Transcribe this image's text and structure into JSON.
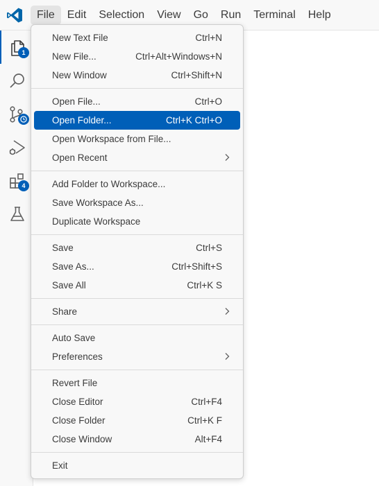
{
  "menubar": {
    "items": [
      {
        "label": "File"
      },
      {
        "label": "Edit"
      },
      {
        "label": "Selection"
      },
      {
        "label": "View"
      },
      {
        "label": "Go"
      },
      {
        "label": "Run"
      },
      {
        "label": "Terminal"
      },
      {
        "label": "Help"
      }
    ]
  },
  "activity_bar": {
    "explorer_badge": "1",
    "extensions_badge": "4",
    "icons": [
      "files-icon",
      "search-icon",
      "source-control-icon",
      "run-debug-icon",
      "extensions-icon",
      "testing-icon"
    ]
  },
  "file_menu": {
    "new_text_file": {
      "label": "New Text File",
      "shortcut": "Ctrl+N"
    },
    "new_file": {
      "label": "New File...",
      "shortcut": "Ctrl+Alt+Windows+N"
    },
    "new_window": {
      "label": "New Window",
      "shortcut": "Ctrl+Shift+N"
    },
    "open_file": {
      "label": "Open File...",
      "shortcut": "Ctrl+O"
    },
    "open_folder": {
      "label": "Open Folder...",
      "shortcut": "Ctrl+K Ctrl+O"
    },
    "open_workspace": {
      "label": "Open Workspace from File..."
    },
    "open_recent": {
      "label": "Open Recent"
    },
    "add_folder": {
      "label": "Add Folder to Workspace..."
    },
    "save_workspace_as": {
      "label": "Save Workspace As..."
    },
    "duplicate_workspace": {
      "label": "Duplicate Workspace"
    },
    "save": {
      "label": "Save",
      "shortcut": "Ctrl+S"
    },
    "save_as": {
      "label": "Save As...",
      "shortcut": "Ctrl+Shift+S"
    },
    "save_all": {
      "label": "Save All",
      "shortcut": "Ctrl+K S"
    },
    "share": {
      "label": "Share"
    },
    "auto_save": {
      "label": "Auto Save"
    },
    "preferences": {
      "label": "Preferences"
    },
    "revert_file": {
      "label": "Revert File"
    },
    "close_editor": {
      "label": "Close Editor",
      "shortcut": "Ctrl+F4"
    },
    "close_folder": {
      "label": "Close Folder",
      "shortcut": "Ctrl+K F"
    },
    "close_window": {
      "label": "Close Window",
      "shortcut": "Alt+F4"
    },
    "exit": {
      "label": "Exit"
    }
  },
  "colors": {
    "accent": "#005fb8",
    "logo": "#0065a9",
    "menu_bg": "#f8f8f8",
    "editor_bg": "#ffffff"
  }
}
